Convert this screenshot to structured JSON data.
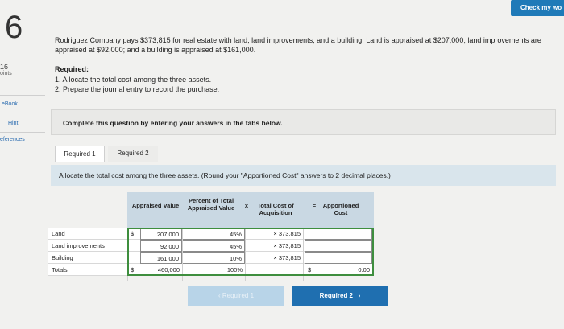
{
  "question": {
    "number": "6",
    "points_value": "16",
    "points_label": "oints",
    "text": "Rodriguez Company pays $373,815 for real estate with land, land improvements, and a building. Land is appraised at $207,000; land improvements are appraised at $92,000; and a building is appraised at $161,000.",
    "required_heading": "Required:",
    "required_items": [
      "1. Allocate the total cost among the three assets.",
      "2. Prepare the journal entry to record the purchase."
    ]
  },
  "header": {
    "check_label": "Check my wo"
  },
  "sidebar": {
    "links": [
      "eBook",
      "Hint",
      "eferences"
    ]
  },
  "instructions": "Complete this question by entering your answers in the tabs below.",
  "tabs": [
    {
      "label": "Required 1",
      "active": true
    },
    {
      "label": "Required 2",
      "active": false
    }
  ],
  "task_prompt": "Allocate the total cost among the three assets. (Round your \"Apportioned Cost\" answers to 2 decimal places.)",
  "table": {
    "headers": {
      "appraised": "Appraised Value",
      "percent": "Percent of Total Appraised Value",
      "x_sign": "x",
      "cost": "Total Cost of Acquisition",
      "eq_sign": "=",
      "apportioned": "Apportioned Cost"
    },
    "rows": [
      {
        "label": "Land",
        "dollar": "$",
        "appraised": "207,000",
        "percent": "45%",
        "cost": "× 373,815",
        "apportioned": ""
      },
      {
        "label": "Land improvements",
        "dollar": "",
        "appraised": "92,000",
        "percent": "45%",
        "cost": "× 373,815",
        "apportioned": ""
      },
      {
        "label": "Building",
        "dollar": "",
        "appraised": "161,000",
        "percent": "10%",
        "cost": "× 373,815",
        "apportioned": ""
      },
      {
        "label": "Totals",
        "dollar": "$",
        "appraised": "460,000",
        "percent": "100%",
        "cost": "",
        "apportioned_dollar": "$",
        "apportioned": "0.00"
      }
    ]
  },
  "nav": {
    "prev_label": "Required 1",
    "next_label": "Required 2"
  },
  "colors": {
    "accent": "#1f6fb0",
    "header_fill": "#c9d8e3",
    "task_bar": "#d9e5ec",
    "input_border_green": "#3e8e3e"
  }
}
